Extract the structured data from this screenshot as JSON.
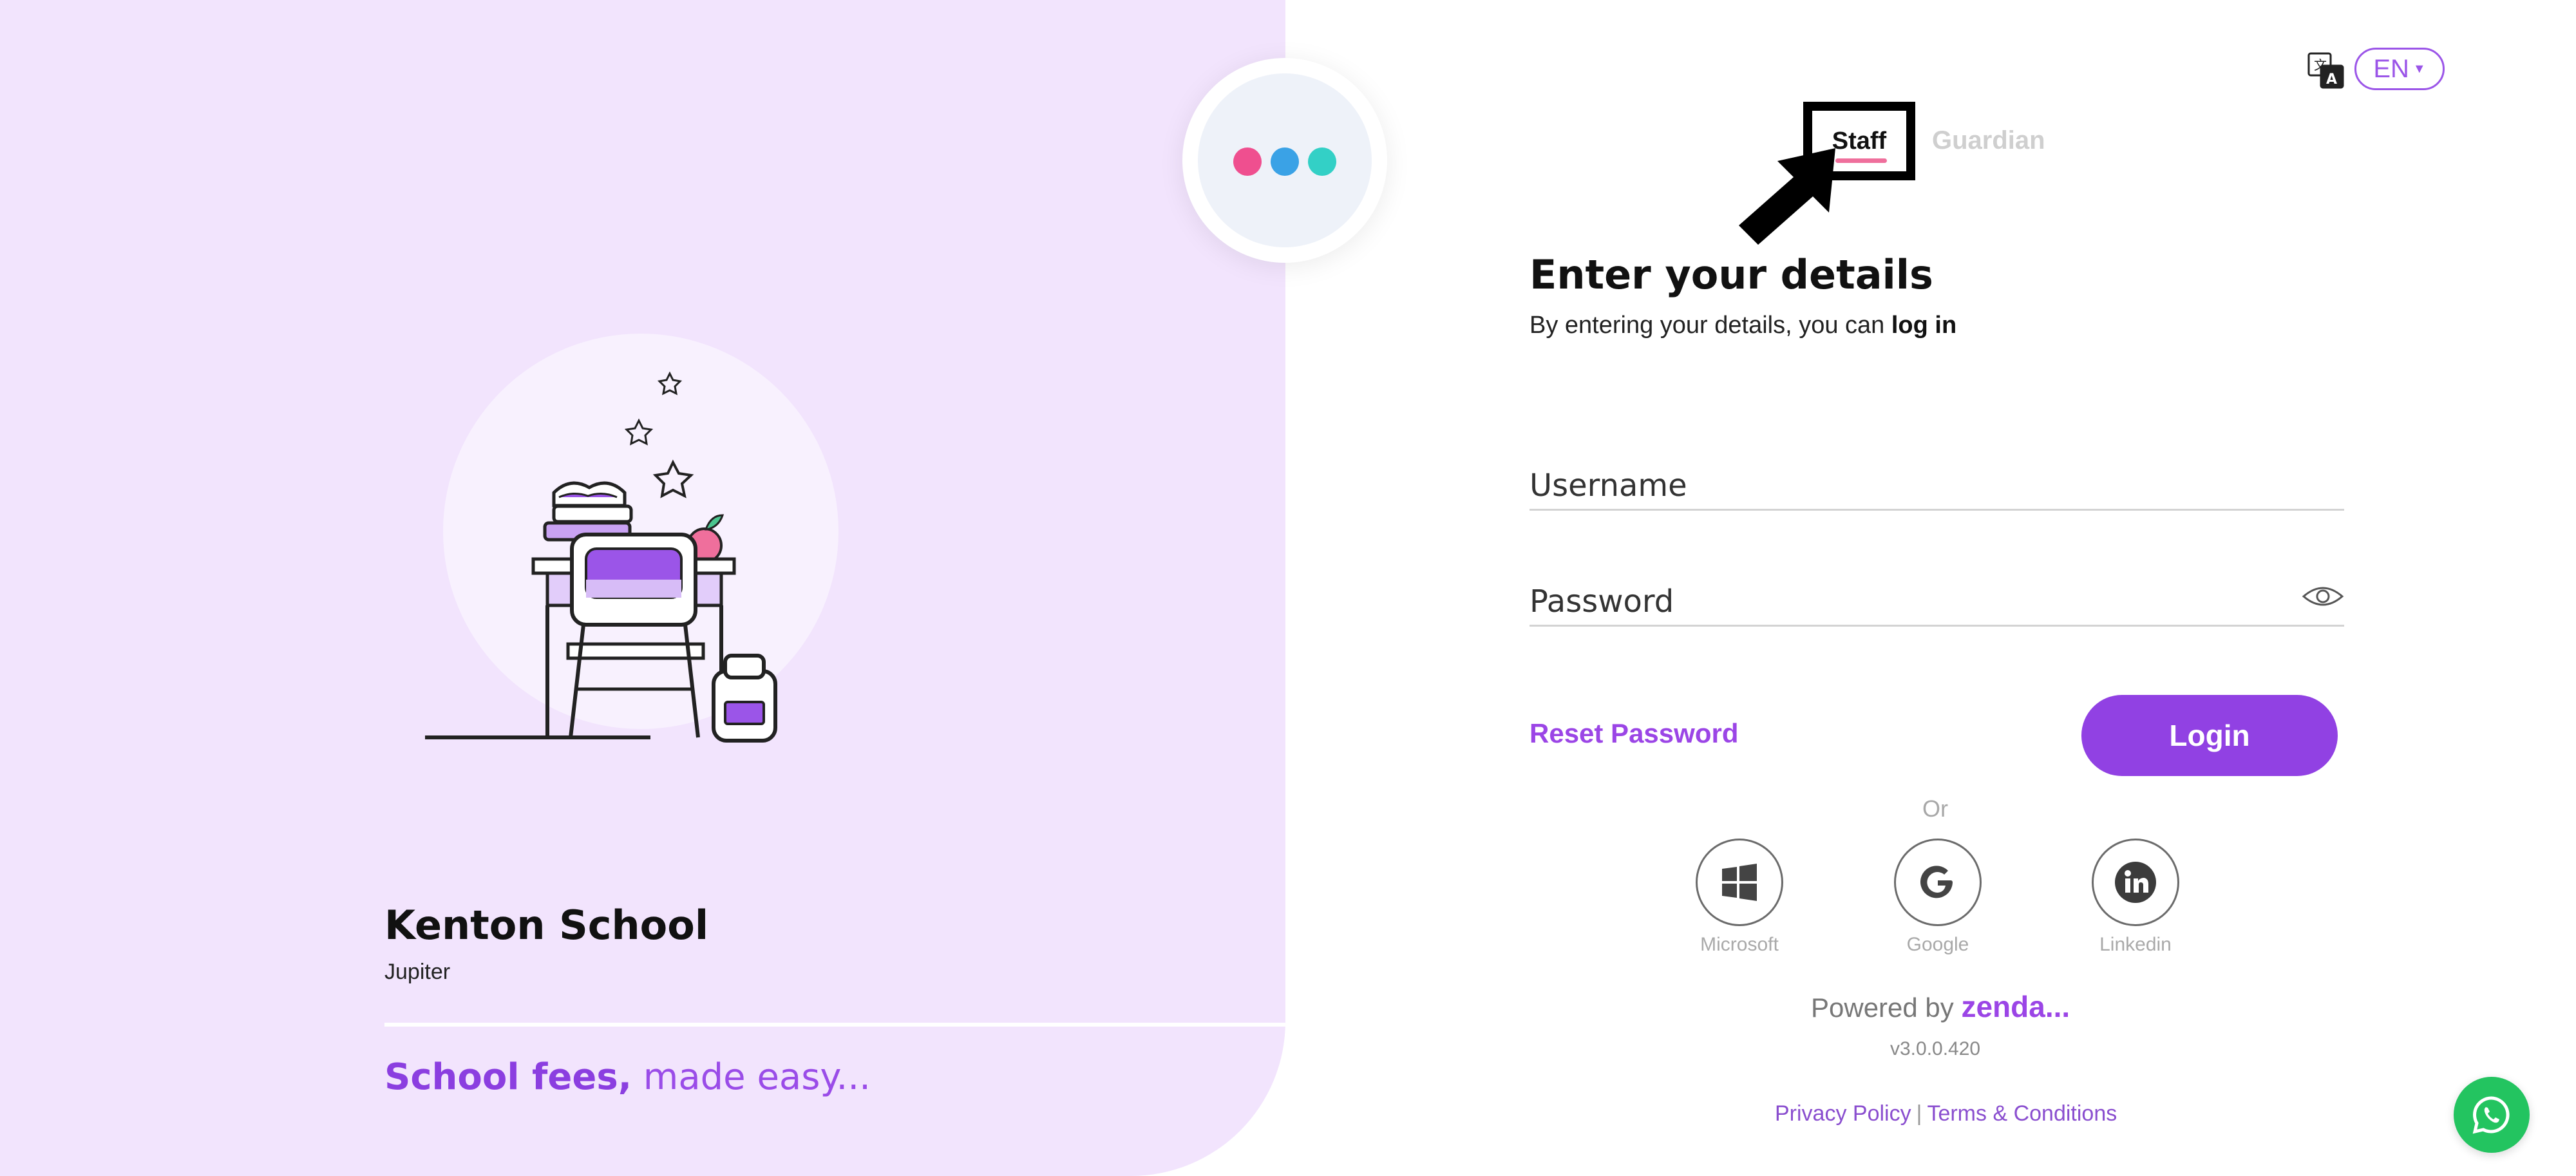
{
  "brand": {
    "logo_dots": [
      "#ef4f8f",
      "#3aa2e6",
      "#33d0c6"
    ],
    "powered_by_text": "Powered by",
    "powered_by_brand": "zenda...",
    "version": "v3.0.0.420"
  },
  "school": {
    "name": "Kenton School",
    "subtitle": "Jupiter",
    "tagline_bold": "School fees,",
    "tagline_rest": " made easy..."
  },
  "language": {
    "icon": "translate-icon",
    "selected": "EN"
  },
  "tabs": [
    {
      "label": "Staff",
      "active": true
    },
    {
      "label": "Guardian",
      "active": false
    }
  ],
  "form": {
    "title": "Enter your details",
    "subtitle_prefix": "By entering your details, you can ",
    "subtitle_bold": "log in",
    "username_placeholder": "Username",
    "username_value": "",
    "password_placeholder": "Password",
    "password_value": "",
    "reset_password_label": "Reset Password",
    "login_label": "Login",
    "or_label": "Or"
  },
  "social_logins": [
    {
      "label": "Microsoft",
      "icon": "windows-icon"
    },
    {
      "label": "Google",
      "icon": "google-icon"
    },
    {
      "label": "Linkedin",
      "icon": "linkedin-icon"
    }
  ],
  "footer": {
    "privacy_label": "Privacy Policy",
    "separator": "|",
    "terms_label": "Terms & Conditions"
  },
  "colors": {
    "accent": "#9141e3",
    "left_panel_bg": "#f2e4fd",
    "tab_underline": "#ef6f9c",
    "whatsapp": "#23c460"
  }
}
